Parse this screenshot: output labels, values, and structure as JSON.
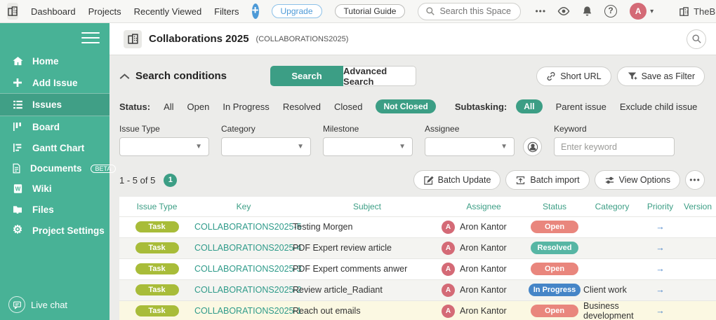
{
  "topbar": {
    "nav": [
      "Dashboard",
      "Projects",
      "Recently Viewed",
      "Filters"
    ],
    "upgrade_label": "Upgrade",
    "tutorial_label": "Tutorial Guide",
    "search_placeholder": "Search this Space",
    "ellipsis": "•••",
    "help_glyph": "?",
    "avatar_initial": "A",
    "caret_glyph": "▾",
    "space_name": "TheBusinessDive"
  },
  "sidebar": {
    "items": [
      {
        "label": "Home"
      },
      {
        "label": "Add Issue"
      },
      {
        "label": "Issues"
      },
      {
        "label": "Board"
      },
      {
        "label": "Gantt Chart"
      },
      {
        "label": "Documents",
        "badge": "BETA"
      },
      {
        "label": "Wiki"
      },
      {
        "label": "Files"
      },
      {
        "label": "Project Settings"
      }
    ],
    "live_chat_label": "Live chat"
  },
  "project": {
    "title": "Collaborations 2025",
    "key": "(COLLABORATIONS2025)"
  },
  "search_conditions": {
    "title": "Search conditions",
    "tabs": [
      {
        "label": "Search",
        "active": true
      },
      {
        "label": "Advanced Search",
        "active": false
      }
    ],
    "short_url_label": "Short URL",
    "save_filter_label": "Save as Filter",
    "status_label": "Status:",
    "status_options": [
      "All",
      "Open",
      "In Progress",
      "Resolved",
      "Closed",
      "Not Closed"
    ],
    "status_selected": "Not Closed",
    "subtasking_label": "Subtasking:",
    "subtasking_options": [
      "All",
      "Parent issue",
      "Exclude child issue"
    ],
    "subtasking_selected": "All",
    "filters": [
      {
        "label": "Issue Type"
      },
      {
        "label": "Category"
      },
      {
        "label": "Milestone"
      },
      {
        "label": "Assignee"
      }
    ],
    "keyword_label": "Keyword",
    "keyword_placeholder": "Enter keyword",
    "keyword_value": ""
  },
  "results": {
    "count_text": "1 - 5 of 5",
    "page_badge": "1",
    "buttons": [
      "Batch Update",
      "Batch import",
      "View Options"
    ],
    "more_glyph": "•••"
  },
  "table": {
    "headers": [
      "Issue Type",
      "Key",
      "Subject",
      "Assignee",
      "Status",
      "Category",
      "Priority",
      "Version"
    ],
    "priority_icon": "→",
    "rows": [
      {
        "issue_type": "Task",
        "key": "COLLABORATIONS2025-5",
        "subject": "Testing Morgen",
        "avatar_initial": "A",
        "assignee": "Aron Kantor",
        "status": "Open",
        "category": "",
        "version": ""
      },
      {
        "issue_type": "Task",
        "key": "COLLABORATIONS2025-4",
        "subject": "PDF Expert review article",
        "avatar_initial": "A",
        "assignee": "Aron Kantor",
        "status": "Resolved",
        "category": "",
        "version": ""
      },
      {
        "issue_type": "Task",
        "key": "COLLABORATIONS2025-3",
        "subject": "PDF Expert comments anwer",
        "avatar_initial": "A",
        "assignee": "Aron Kantor",
        "status": "Open",
        "category": "",
        "version": ""
      },
      {
        "issue_type": "Task",
        "key": "COLLABORATIONS2025-2",
        "subject": "Review article_Radiant",
        "avatar_initial": "A",
        "assignee": "Aron Kantor",
        "status": "In Progress",
        "category": "Client work",
        "version": ""
      },
      {
        "issue_type": "Task",
        "key": "COLLABORATIONS2025-1",
        "subject": "Reach out emails",
        "avatar_initial": "A",
        "assignee": "Aron Kantor",
        "status": "Open",
        "category": "Business development",
        "version": ""
      }
    ]
  },
  "colors": {
    "sidebar_green": "#48B296",
    "accent_green": "#3C9E85",
    "link_teal": "#2F9B8A",
    "task_pill": "#A8BC39",
    "status_open": "#E9867D",
    "status_resolved": "#57B6A4",
    "status_in_progress": "#4585C7",
    "avatar_pink": "#D46A76",
    "plus_blue": "#4D9AD7",
    "highlight_row": "#FBF8E2"
  }
}
